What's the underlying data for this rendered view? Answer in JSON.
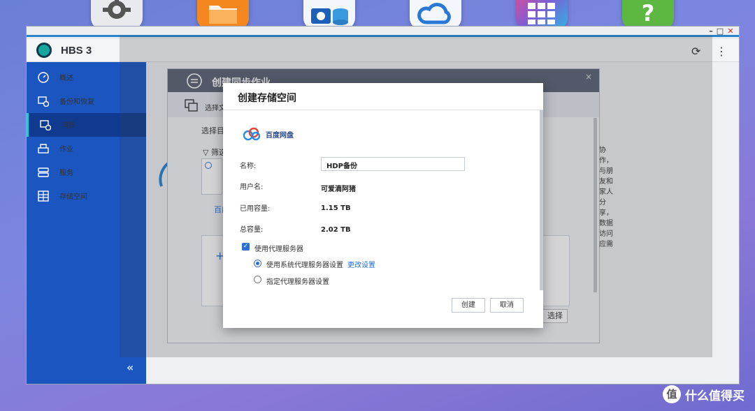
{
  "dock": {
    "icons": [
      "gear-icon",
      "folder-icon",
      "photo-station-icon",
      "cloud-icon",
      "grid-icon",
      "help-icon"
    ]
  },
  "window": {
    "app_title": "HBS 3",
    "controls": {
      "minimize": "–",
      "maximize": "□",
      "close": "✕"
    },
    "refresh_icon": "⟳",
    "more_icon": "⋮"
  },
  "sidebar": {
    "items": [
      {
        "label": "概述"
      },
      {
        "label": "备份和恢复"
      },
      {
        "label": "同步"
      },
      {
        "label": "作业"
      },
      {
        "label": "服务"
      },
      {
        "label": "存储空间"
      }
    ],
    "collapse": "«"
  },
  "background_dialog": {
    "title": "创建同步作业",
    "step": "选择文件夹",
    "prompt": "选择目的地",
    "filter": "筛选",
    "provider_short": "百度",
    "side_text": "协作，与朋友和家人分享，数据访问应需",
    "plus": "+",
    "select_button": "选择",
    "close": "×"
  },
  "modal": {
    "title": "创建存储空间",
    "provider": "百度网盘",
    "fields": {
      "name_label": "名称:",
      "name_value": "HDP备份",
      "user_label": "用户名:",
      "user_value": "可爱滴阿猪",
      "used_label": "已用容量:",
      "used_value": "1.15 TB",
      "total_label": "总容量:",
      "total_value": "2.02 TB"
    },
    "proxy": {
      "checkbox_label": "使用代理服务器",
      "checked": true,
      "option_system": "使用系统代理服务器设置",
      "change_link": "更改设置",
      "option_custom": "指定代理服务器设置"
    },
    "buttons": {
      "create": "创建",
      "cancel": "取消"
    }
  },
  "watermark": {
    "badge": "值",
    "text": "什么值得买"
  },
  "colors": {
    "sidebar": "#1a55c0",
    "sidebar_active": "#0f3a8f",
    "accent": "#2d6fd3",
    "titlebar_line": "#2a82c9"
  }
}
